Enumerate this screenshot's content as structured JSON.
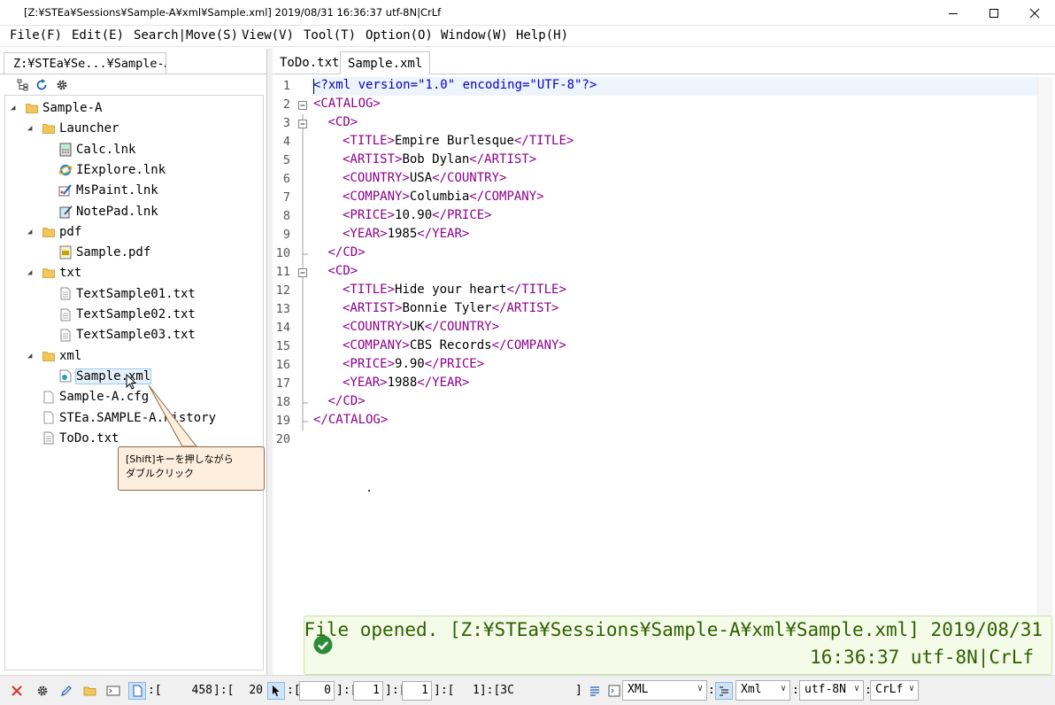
{
  "window": {
    "title": "[Z:¥STEa¥Sessions¥Sample-A¥xml¥Sample.xml] 2019/08/31 16:36:37 utf-8N|CrLf"
  },
  "menu": [
    "File(F)",
    "Edit(E)",
    "Search|Move(S)",
    "View(V)",
    "Tool(T)",
    "Option(O)",
    "Window(W)",
    "Help(H)"
  ],
  "left_panel": {
    "tab_label": "Z:¥STEa¥Se...¥Sample-A",
    "tree": [
      {
        "label": "Sample-A",
        "icon": "folder-icon",
        "expanded": true
      },
      {
        "label": "Launcher",
        "icon": "folder-icon",
        "expanded": true
      },
      {
        "label": "Calc.lnk",
        "icon": "calculator-icon"
      },
      {
        "label": "IExplore.lnk",
        "icon": "internet-explorer-icon"
      },
      {
        "label": "MsPaint.lnk",
        "icon": "paint-icon"
      },
      {
        "label": "NotePad.lnk",
        "icon": "notepad-icon"
      },
      {
        "label": "pdf",
        "icon": "folder-icon",
        "expanded": true
      },
      {
        "label": "Sample.pdf",
        "icon": "pdf-file-icon"
      },
      {
        "label": "txt",
        "icon": "folder-icon",
        "expanded": true
      },
      {
        "label": "TextSample01.txt",
        "icon": "text-file-icon"
      },
      {
        "label": "TextSample02.txt",
        "icon": "text-file-icon"
      },
      {
        "label": "TextSample03.txt",
        "icon": "text-file-icon"
      },
      {
        "label": "xml",
        "icon": "folder-icon",
        "expanded": true
      },
      {
        "label": "Sample.xml",
        "icon": "xml-file-icon",
        "selected": true
      },
      {
        "label": "Sample-A.cfg",
        "icon": "file-icon"
      },
      {
        "label": "STEa.SAMPLE-A.history",
        "icon": "file-icon"
      },
      {
        "label": "ToDo.txt",
        "icon": "text-file-icon"
      }
    ],
    "callout": {
      "line1": "[Shift]キーを押しながら",
      "line2": "ダブルクリック"
    }
  },
  "editor": {
    "tabs": [
      "ToDo.txt",
      "Sample.xml"
    ],
    "active_tab": "Sample.xml",
    "line_numbers": [
      "1",
      "2",
      "3",
      "4",
      "5",
      "6",
      "7",
      "8",
      "9",
      "10",
      "11",
      "12",
      "13",
      "14",
      "15",
      "16",
      "17",
      "18",
      "19",
      "20"
    ],
    "lines": [
      {
        "indent": 0,
        "parts": [
          [
            "pi",
            "<?xml version=\"1.0\" encoding=\"UTF-8\"?>"
          ]
        ]
      },
      {
        "indent": 0,
        "parts": [
          [
            "t",
            "<CATALOG>"
          ]
        ]
      },
      {
        "indent": 1,
        "parts": [
          [
            "t",
            "<CD>"
          ]
        ]
      },
      {
        "indent": 2,
        "parts": [
          [
            "t",
            "<TITLE>"
          ],
          [
            "tx",
            "Empire Burlesque"
          ],
          [
            "t",
            "</TITLE>"
          ]
        ]
      },
      {
        "indent": 2,
        "parts": [
          [
            "t",
            "<ARTIST>"
          ],
          [
            "tx",
            "Bob Dylan"
          ],
          [
            "t",
            "</ARTIST>"
          ]
        ]
      },
      {
        "indent": 2,
        "parts": [
          [
            "t",
            "<COUNTRY>"
          ],
          [
            "tx",
            "USA"
          ],
          [
            "t",
            "</COUNTRY>"
          ]
        ]
      },
      {
        "indent": 2,
        "parts": [
          [
            "t",
            "<COMPANY>"
          ],
          [
            "tx",
            "Columbia"
          ],
          [
            "t",
            "</COMPANY>"
          ]
        ]
      },
      {
        "indent": 2,
        "parts": [
          [
            "t",
            "<PRICE>"
          ],
          [
            "tx",
            "10.90"
          ],
          [
            "t",
            "</PRICE>"
          ]
        ]
      },
      {
        "indent": 2,
        "parts": [
          [
            "t",
            "<YEAR>"
          ],
          [
            "tx",
            "1985"
          ],
          [
            "t",
            "</YEAR>"
          ]
        ]
      },
      {
        "indent": 1,
        "parts": [
          [
            "t",
            "</CD>"
          ]
        ]
      },
      {
        "indent": 1,
        "parts": [
          [
            "t",
            "<CD>"
          ]
        ]
      },
      {
        "indent": 2,
        "parts": [
          [
            "t",
            "<TITLE>"
          ],
          [
            "tx",
            "Hide your heart"
          ],
          [
            "t",
            "</TITLE>"
          ]
        ]
      },
      {
        "indent": 2,
        "parts": [
          [
            "t",
            "<ARTIST>"
          ],
          [
            "tx",
            "Bonnie Tyler"
          ],
          [
            "t",
            "</ARTIST>"
          ]
        ]
      },
      {
        "indent": 2,
        "parts": [
          [
            "t",
            "<COUNTRY>"
          ],
          [
            "tx",
            "UK"
          ],
          [
            "t",
            "</COUNTRY>"
          ]
        ]
      },
      {
        "indent": 2,
        "parts": [
          [
            "t",
            "<COMPANY>"
          ],
          [
            "tx",
            "CBS Records"
          ],
          [
            "t",
            "</COMPANY>"
          ]
        ]
      },
      {
        "indent": 2,
        "parts": [
          [
            "t",
            "<PRICE>"
          ],
          [
            "tx",
            "9.90"
          ],
          [
            "t",
            "</PRICE>"
          ]
        ]
      },
      {
        "indent": 2,
        "parts": [
          [
            "t",
            "<YEAR>"
          ],
          [
            "tx",
            "1988"
          ],
          [
            "t",
            "</YEAR>"
          ]
        ]
      },
      {
        "indent": 1,
        "parts": [
          [
            "t",
            "</CD>"
          ]
        ]
      },
      {
        "indent": 0,
        "parts": [
          [
            "t",
            "</CATALOG>"
          ]
        ]
      },
      {
        "indent": 0,
        "parts": []
      }
    ],
    "fold_markers": {
      "2": "minus",
      "3": "minus",
      "10": "end",
      "11": "minus",
      "18": "end",
      "19": "end"
    }
  },
  "notification": {
    "line1": "File opened. [Z:¥STEa¥Sessions¥Sample-A¥xml¥Sample.xml] 2019/08/31",
    "line2": "16:36:37 utf-8N|CrLf"
  },
  "statusbar": {
    "pos_a": "458",
    "pos_b": "20",
    "field1": "0",
    "field2": "1",
    "field3": "1",
    "field4_text": "1]:[3C",
    "syntax_mode": "XML",
    "file_type": "Xml",
    "encoding": "utf-8N",
    "line_ending": "CrLf"
  },
  "colors": {
    "tag": "#8b008b",
    "pi": "#0000cd",
    "notify_text": "#2f5f00",
    "notify_bg": "#f4fbe8",
    "callout_bg": "#fdeedd",
    "close_icon_red": "#d9302c"
  }
}
